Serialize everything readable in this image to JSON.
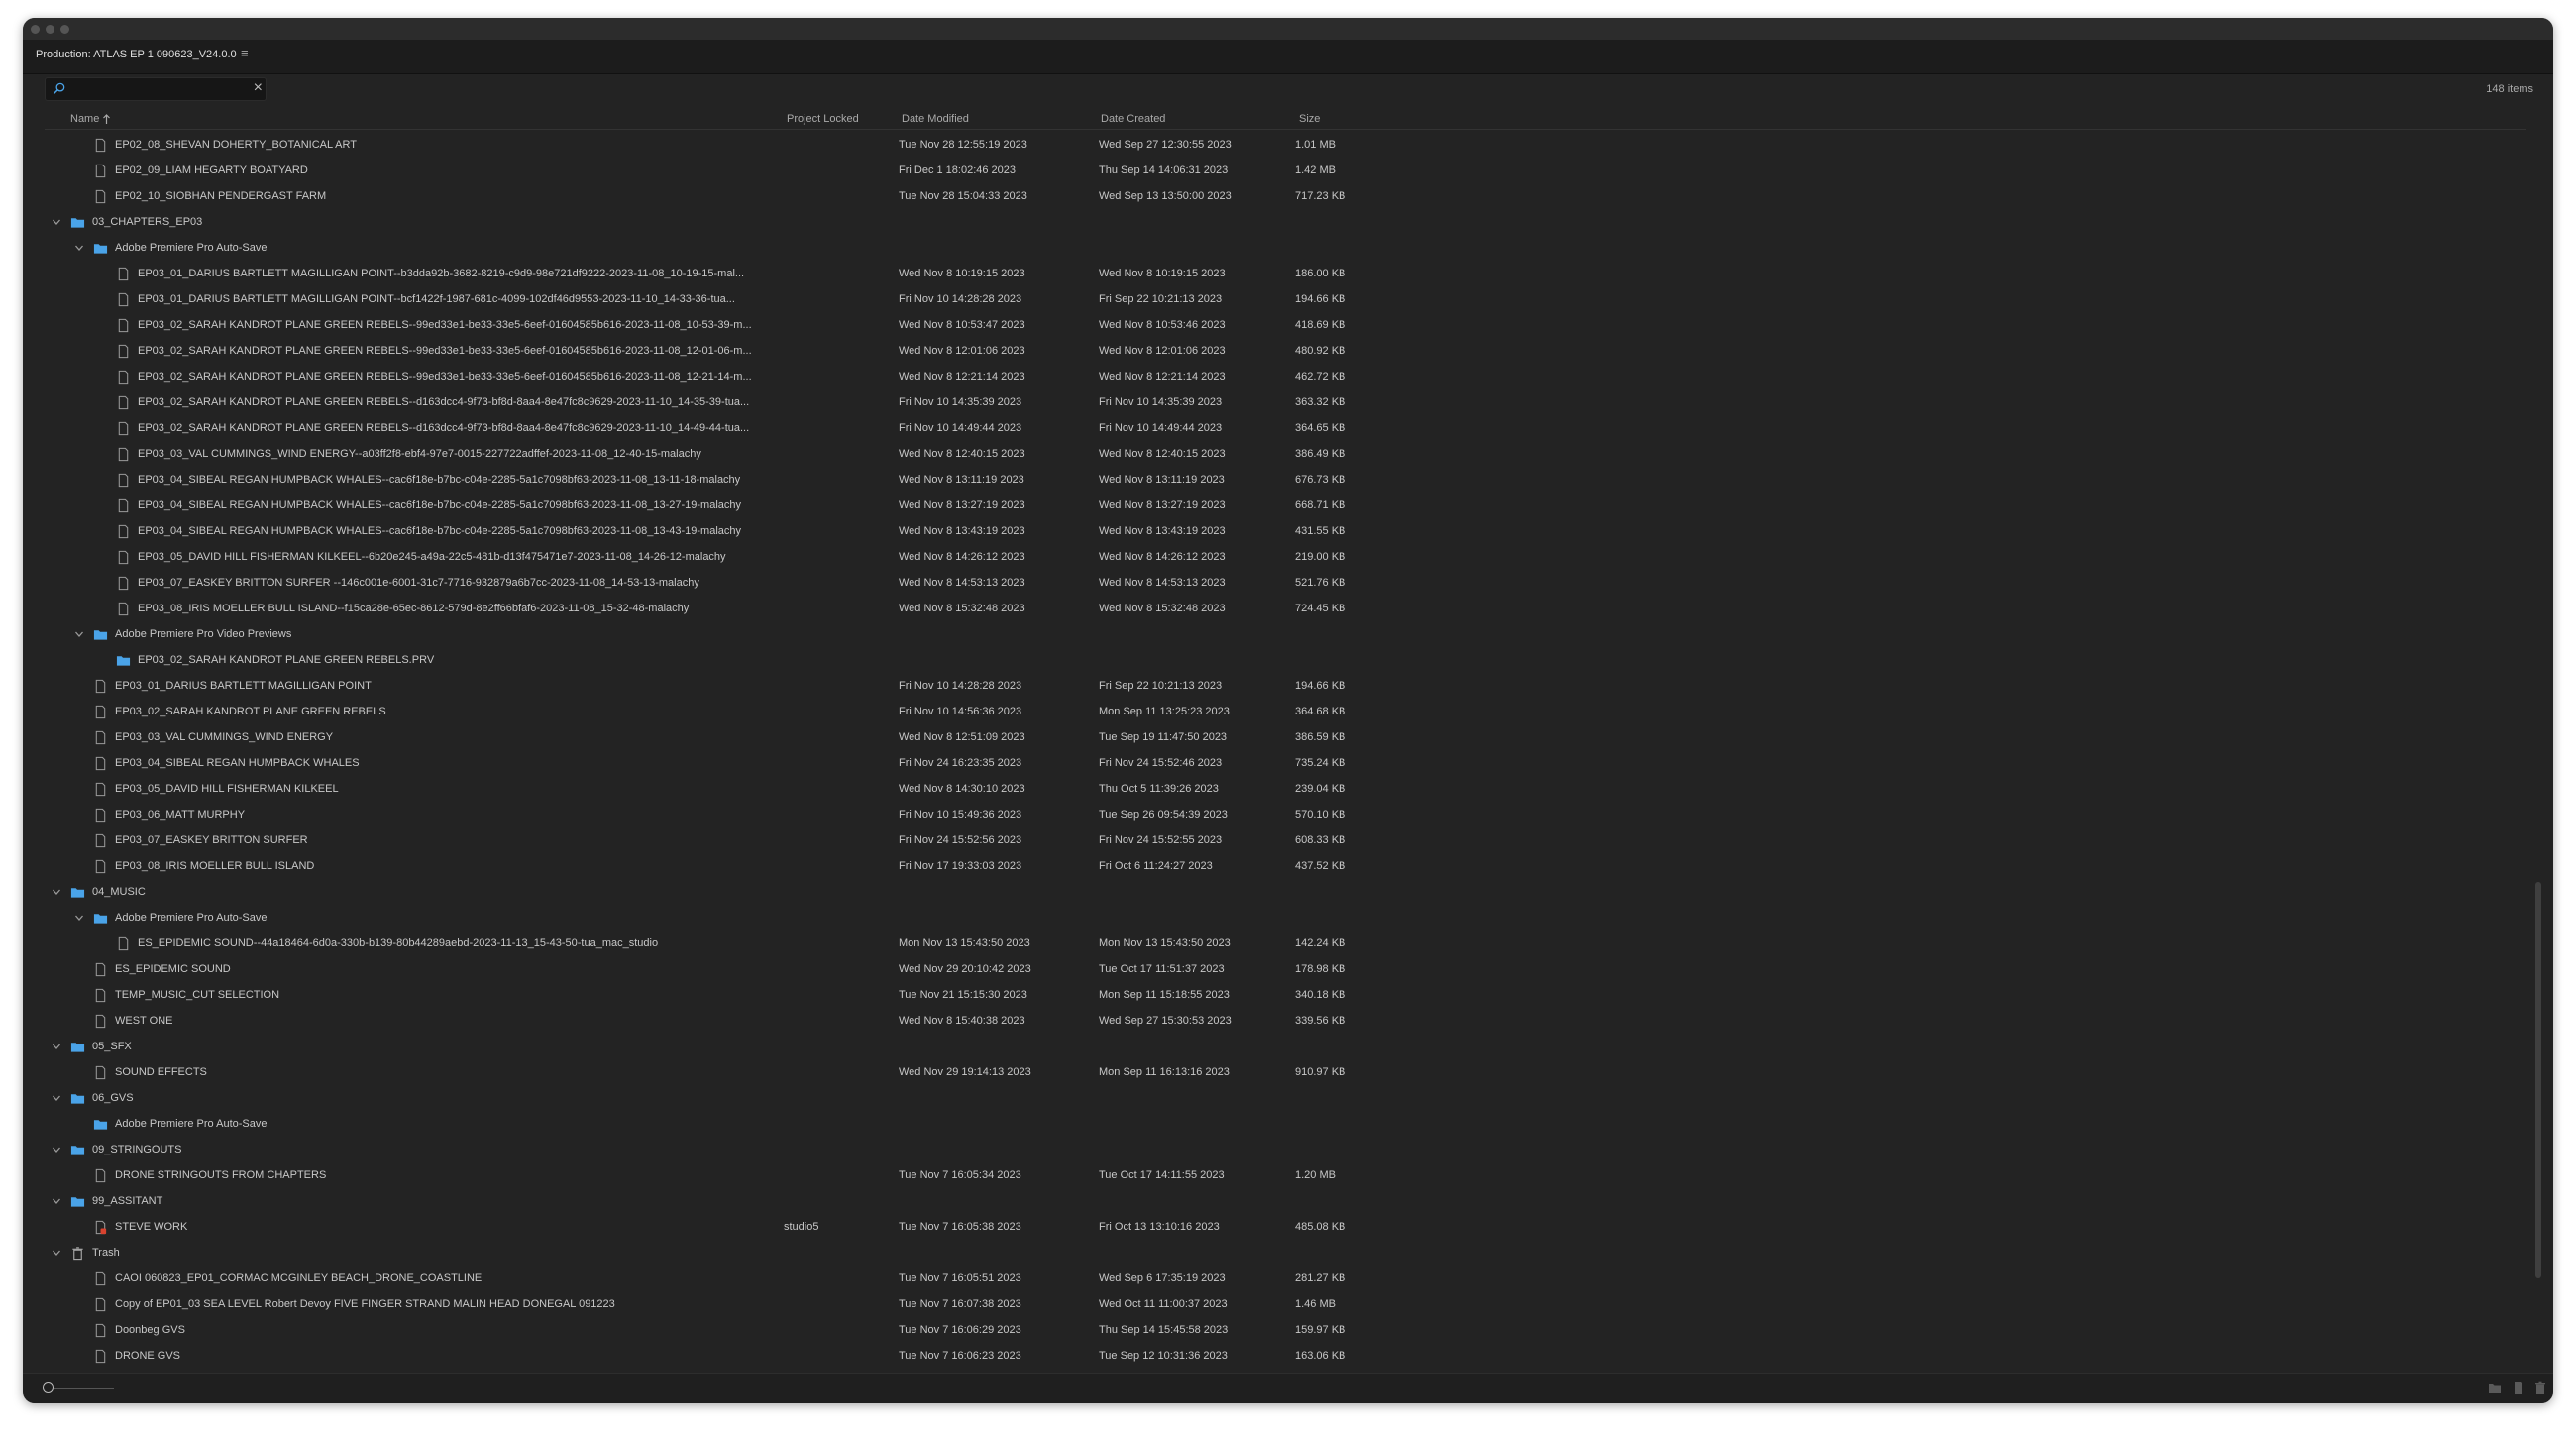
{
  "panel": {
    "title": "Production: ATLAS EP 1 090623_V24.0.0",
    "item_count": "148 items",
    "search_placeholder": ""
  },
  "columns": {
    "name": "Name",
    "project_locked": "Project Locked",
    "date_modified": "Date Modified",
    "date_created": "Date Created",
    "size": "Size"
  },
  "icons": {
    "folder": "folder-icon",
    "file": "file-icon",
    "locked_file": "locked-file-icon",
    "trash": "trash-icon",
    "chevron": "chevron-down-icon",
    "new_folder": "new-folder-icon",
    "new_item": "new-item-icon",
    "delete": "delete-icon"
  },
  "colors": {
    "background": "#232323",
    "folder": "#4aa3e8",
    "text": "#c8c8c8",
    "lock_badge": "#d9432f"
  },
  "rows": [
    {
      "depth": 1,
      "type": "file",
      "name": "EP02_08_SHEVAN DOHERTY_BOTANICAL ART",
      "modified": "Tue Nov 28 12:55:19 2023",
      "created": "Wed Sep 27 12:30:55 2023",
      "size": "1.01 MB"
    },
    {
      "depth": 1,
      "type": "file",
      "name": "EP02_09_LIAM HEGARTY BOATYARD",
      "modified": "Fri Dec  1 18:02:46 2023",
      "created": "Thu Sep 14 14:06:31 2023",
      "size": "1.42 MB"
    },
    {
      "depth": 1,
      "type": "file",
      "name": "EP02_10_SIOBHAN PENDERGAST FARM",
      "modified": "Tue Nov 28 15:04:33 2023",
      "created": "Wed Sep 13 13:50:00 2023",
      "size": "717.23 KB"
    },
    {
      "depth": 0,
      "type": "folder",
      "expanded": true,
      "name": "03_CHAPTERS_EP03"
    },
    {
      "depth": 1,
      "type": "folder",
      "expanded": true,
      "name": "Adobe Premiere Pro Auto-Save"
    },
    {
      "depth": 2,
      "type": "file",
      "name": "EP03_01_DARIUS BARTLETT MAGILLIGAN POINT--b3dda92b-3682-8219-c9d9-98e721df9222-2023-11-08_10-19-15-mal...",
      "modified": "Wed Nov  8 10:19:15 2023",
      "created": "Wed Nov  8 10:19:15 2023",
      "size": "186.00 KB"
    },
    {
      "depth": 2,
      "type": "file",
      "name": "EP03_01_DARIUS BARTLETT MAGILLIGAN POINT--bcf1422f-1987-681c-4099-102df46d9553-2023-11-10_14-33-36-tua...",
      "modified": "Fri Nov 10 14:28:28 2023",
      "created": "Fri Sep 22 10:21:13 2023",
      "size": "194.66 KB"
    },
    {
      "depth": 2,
      "type": "file",
      "name": "EP03_02_SARAH KANDROT PLANE GREEN REBELS--99ed33e1-be33-33e5-6eef-01604585b616-2023-11-08_10-53-39-m...",
      "modified": "Wed Nov  8 10:53:47 2023",
      "created": "Wed Nov  8 10:53:46 2023",
      "size": "418.69 KB"
    },
    {
      "depth": 2,
      "type": "file",
      "name": "EP03_02_SARAH KANDROT PLANE GREEN REBELS--99ed33e1-be33-33e5-6eef-01604585b616-2023-11-08_12-01-06-m...",
      "modified": "Wed Nov  8 12:01:06 2023",
      "created": "Wed Nov  8 12:01:06 2023",
      "size": "480.92 KB"
    },
    {
      "depth": 2,
      "type": "file",
      "name": "EP03_02_SARAH KANDROT PLANE GREEN REBELS--99ed33e1-be33-33e5-6eef-01604585b616-2023-11-08_12-21-14-m...",
      "modified": "Wed Nov  8 12:21:14 2023",
      "created": "Wed Nov  8 12:21:14 2023",
      "size": "462.72 KB"
    },
    {
      "depth": 2,
      "type": "file",
      "name": "EP03_02_SARAH KANDROT PLANE GREEN REBELS--d163dcc4-9f73-bf8d-8aa4-8e47fc8c9629-2023-11-10_14-35-39-tua...",
      "modified": "Fri Nov 10 14:35:39 2023",
      "created": "Fri Nov 10 14:35:39 2023",
      "size": "363.32 KB"
    },
    {
      "depth": 2,
      "type": "file",
      "name": "EP03_02_SARAH KANDROT PLANE GREEN REBELS--d163dcc4-9f73-bf8d-8aa4-8e47fc8c9629-2023-11-10_14-49-44-tua...",
      "modified": "Fri Nov 10 14:49:44 2023",
      "created": "Fri Nov 10 14:49:44 2023",
      "size": "364.65 KB"
    },
    {
      "depth": 2,
      "type": "file",
      "name": "EP03_03_VAL CUMMINGS_WIND ENERGY--a03ff2f8-ebf4-97e7-0015-227722adffef-2023-11-08_12-40-15-malachy",
      "modified": "Wed Nov  8 12:40:15 2023",
      "created": "Wed Nov  8 12:40:15 2023",
      "size": "386.49 KB"
    },
    {
      "depth": 2,
      "type": "file",
      "name": "EP03_04_SIBEAL REGAN HUMPBACK WHALES--cac6f18e-b7bc-c04e-2285-5a1c7098bf63-2023-11-08_13-11-18-malachy",
      "modified": "Wed Nov  8 13:11:19 2023",
      "created": "Wed Nov  8 13:11:19 2023",
      "size": "676.73 KB"
    },
    {
      "depth": 2,
      "type": "file",
      "name": "EP03_04_SIBEAL REGAN HUMPBACK WHALES--cac6f18e-b7bc-c04e-2285-5a1c7098bf63-2023-11-08_13-27-19-malachy",
      "modified": "Wed Nov  8 13:27:19 2023",
      "created": "Wed Nov  8 13:27:19 2023",
      "size": "668.71 KB"
    },
    {
      "depth": 2,
      "type": "file",
      "name": "EP03_04_SIBEAL REGAN HUMPBACK WHALES--cac6f18e-b7bc-c04e-2285-5a1c7098bf63-2023-11-08_13-43-19-malachy",
      "modified": "Wed Nov  8 13:43:19 2023",
      "created": "Wed Nov  8 13:43:19 2023",
      "size": "431.55 KB"
    },
    {
      "depth": 2,
      "type": "file",
      "name": "EP03_05_DAVID HILL FISHERMAN KILKEEL--6b20e245-a49a-22c5-481b-d13f475471e7-2023-11-08_14-26-12-malachy",
      "modified": "Wed Nov  8 14:26:12 2023",
      "created": "Wed Nov  8 14:26:12 2023",
      "size": "219.00 KB"
    },
    {
      "depth": 2,
      "type": "file",
      "name": "EP03_07_EASKEY BRITTON SURFER --146c001e-6001-31c7-7716-932879a6b7cc-2023-11-08_14-53-13-malachy",
      "modified": "Wed Nov  8 14:53:13 2023",
      "created": "Wed Nov  8 14:53:13 2023",
      "size": "521.76 KB"
    },
    {
      "depth": 2,
      "type": "file",
      "name": "EP03_08_IRIS MOELLER BULL ISLAND--f15ca28e-65ec-8612-579d-8e2ff66bfaf6-2023-11-08_15-32-48-malachy",
      "modified": "Wed Nov  8 15:32:48 2023",
      "created": "Wed Nov  8 15:32:48 2023",
      "size": "724.45 KB"
    },
    {
      "depth": 1,
      "type": "folder",
      "expanded": true,
      "name": "Adobe Premiere Pro Video Previews"
    },
    {
      "depth": 2,
      "type": "folder",
      "name": "EP03_02_SARAH KANDROT PLANE GREEN REBELS.PRV"
    },
    {
      "depth": 1,
      "type": "file",
      "name": "EP03_01_DARIUS BARTLETT MAGILLIGAN POINT",
      "modified": "Fri Nov 10 14:28:28 2023",
      "created": "Fri Sep 22 10:21:13 2023",
      "size": "194.66 KB"
    },
    {
      "depth": 1,
      "type": "file",
      "name": "EP03_02_SARAH KANDROT PLANE GREEN REBELS",
      "modified": "Fri Nov 10 14:56:36 2023",
      "created": "Mon Sep 11 13:25:23 2023",
      "size": "364.68 KB"
    },
    {
      "depth": 1,
      "type": "file",
      "name": "EP03_03_VAL CUMMINGS_WIND ENERGY",
      "modified": "Wed Nov  8 12:51:09 2023",
      "created": "Tue Sep 19 11:47:50 2023",
      "size": "386.59 KB"
    },
    {
      "depth": 1,
      "type": "file",
      "name": "EP03_04_SIBEAL REGAN HUMPBACK WHALES",
      "modified": "Fri Nov 24 16:23:35 2023",
      "created": "Fri Nov 24 15:52:46 2023",
      "size": "735.24 KB"
    },
    {
      "depth": 1,
      "type": "file",
      "name": "EP03_05_DAVID HILL FISHERMAN KILKEEL",
      "modified": "Wed Nov  8 14:30:10 2023",
      "created": "Thu Oct  5 11:39:26 2023",
      "size": "239.04 KB"
    },
    {
      "depth": 1,
      "type": "file",
      "name": "EP03_06_MATT MURPHY",
      "modified": "Fri Nov 10 15:49:36 2023",
      "created": "Tue Sep 26 09:54:39 2023",
      "size": "570.10 KB"
    },
    {
      "depth": 1,
      "type": "file",
      "name": "EP03_07_EASKEY BRITTON SURFER",
      "modified": "Fri Nov 24 15:52:56 2023",
      "created": "Fri Nov 24 15:52:55 2023",
      "size": "608.33 KB"
    },
    {
      "depth": 1,
      "type": "file",
      "name": "EP03_08_IRIS MOELLER BULL ISLAND",
      "modified": "Fri Nov 17 19:33:03 2023",
      "created": "Fri Oct  6 11:24:27 2023",
      "size": "437.52 KB"
    },
    {
      "depth": 0,
      "type": "folder",
      "expanded": true,
      "name": "04_MUSIC"
    },
    {
      "depth": 1,
      "type": "folder",
      "expanded": true,
      "name": "Adobe Premiere Pro Auto-Save"
    },
    {
      "depth": 2,
      "type": "file",
      "name": "ES_EPIDEMIC SOUND--44a18464-6d0a-330b-b139-80b44289aebd-2023-11-13_15-43-50-tua_mac_studio",
      "modified": "Mon Nov 13 15:43:50 2023",
      "created": "Mon Nov 13 15:43:50 2023",
      "size": "142.24 KB"
    },
    {
      "depth": 1,
      "type": "file",
      "name": "ES_EPIDEMIC SOUND",
      "modified": "Wed Nov 29 20:10:42 2023",
      "created": "Tue Oct 17 11:51:37 2023",
      "size": "178.98 KB"
    },
    {
      "depth": 1,
      "type": "file",
      "name": "TEMP_MUSIC_CUT SELECTION",
      "modified": "Tue Nov 21 15:15:30 2023",
      "created": "Mon Sep 11 15:18:55 2023",
      "size": "340.18 KB"
    },
    {
      "depth": 1,
      "type": "file",
      "name": "WEST ONE",
      "modified": "Wed Nov  8 15:40:38 2023",
      "created": "Wed Sep 27 15:30:53 2023",
      "size": "339.56 KB"
    },
    {
      "depth": 0,
      "type": "folder",
      "expanded": true,
      "name": "05_SFX"
    },
    {
      "depth": 1,
      "type": "file",
      "name": "SOUND EFFECTS",
      "modified": "Wed Nov 29 19:14:13 2023",
      "created": "Mon Sep 11 16:13:16 2023",
      "size": "910.97 KB"
    },
    {
      "depth": 0,
      "type": "folder",
      "expanded": true,
      "name": "06_GVS"
    },
    {
      "depth": 1,
      "type": "folder",
      "name": "Adobe Premiere Pro Auto-Save"
    },
    {
      "depth": 0,
      "type": "folder",
      "expanded": true,
      "name": "09_STRINGOUTS"
    },
    {
      "depth": 1,
      "type": "file",
      "name": "DRONE STRINGOUTS FROM CHAPTERS",
      "modified": "Tue Nov  7 16:05:34 2023",
      "created": "Tue Oct 17 14:11:55 2023",
      "size": "1.20 MB"
    },
    {
      "depth": 0,
      "type": "folder",
      "expanded": true,
      "name": "99_ASSITANT"
    },
    {
      "depth": 1,
      "type": "locked",
      "name": "STEVE WORK",
      "locked": "studio5",
      "modified": "Tue Nov  7 16:05:38 2023",
      "created": "Fri Oct 13 13:10:16 2023",
      "size": "485.08 KB"
    },
    {
      "depth": 0,
      "type": "trash",
      "expanded": true,
      "name": "Trash"
    },
    {
      "depth": 1,
      "type": "file",
      "name": "CAOI 060823_EP01_CORMAC MCGINLEY BEACH_DRONE_COASTLINE",
      "modified": "Tue Nov  7 16:05:51 2023",
      "created": "Wed Sep  6 17:35:19 2023",
      "size": "281.27 KB"
    },
    {
      "depth": 1,
      "type": "file",
      "name": "Copy of EP01_03 SEA LEVEL Robert Devoy FIVE FINGER STRAND MALIN HEAD DONEGAL     091223",
      "modified": "Tue Nov  7 16:07:38 2023",
      "created": "Wed Oct 11 11:00:37 2023",
      "size": "1.46 MB"
    },
    {
      "depth": 1,
      "type": "file",
      "name": "Doonbeg GVS",
      "modified": "Tue Nov  7 16:06:29 2023",
      "created": "Thu Sep 14 15:45:58 2023",
      "size": "159.97 KB"
    },
    {
      "depth": 1,
      "type": "file",
      "name": "DRONE GVS",
      "modified": "Tue Nov  7 16:06:23 2023",
      "created": "Tue Sep 12 10:31:36 2023",
      "size": "163.06 KB"
    }
  ]
}
